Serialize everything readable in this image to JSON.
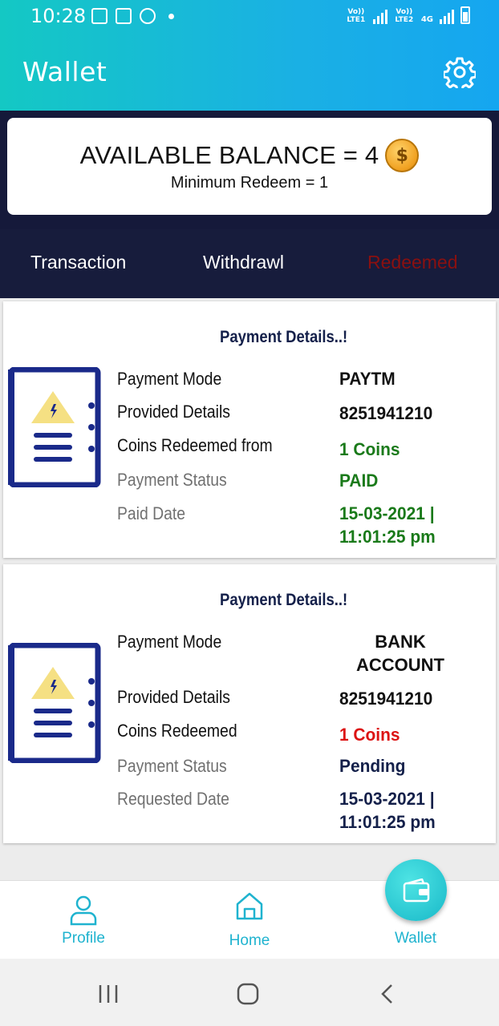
{
  "status_bar": {
    "time": "10:28",
    "sim1": "Vo)) LTE1",
    "sim2": "Vo)) LTE2",
    "network": "4G"
  },
  "header": {
    "title": "Wallet"
  },
  "balance": {
    "text": "AVAILABLE BALANCE = 4",
    "coin_symbol": "$",
    "minimum": "Minimum Redeem = 1"
  },
  "tabs": {
    "transaction": "Transaction",
    "withdrawl": "Withdrawl",
    "redeemed": "Redeemed"
  },
  "payments": [
    {
      "title": "Payment Details..!",
      "mode_label": "Payment Mode",
      "mode_value": "PAYTM",
      "details_label": "Provided Details",
      "details_value": "8251941210",
      "coins_label": "Coins Redeemed from",
      "coins_value": "1 Coins",
      "status_label": "Payment Status",
      "status_value": "PAID",
      "date_label": "Paid Date",
      "date_value_line1": "15-03-2021 |",
      "date_value_line2": "11:01:25 pm"
    },
    {
      "title": "Payment Details..!",
      "mode_label": "Payment Mode",
      "mode_value_line1": "BANK",
      "mode_value_line2": "ACCOUNT",
      "details_label": "Provided Details",
      "details_value": "8251941210",
      "coins_label": "Coins Redeemed",
      "coins_value": "1 Coins",
      "status_label": "Payment Status",
      "status_value": "Pending",
      "date_label": "Requested Date",
      "date_value_line1": "15-03-2021 |",
      "date_value_line2": "11:01:25 pm"
    }
  ],
  "bottom_nav": {
    "profile": "Profile",
    "home": "Home",
    "wallet": "Wallet"
  },
  "colors": {
    "header_gradient_start": "#14c8c4",
    "header_gradient_end": "#15a6f0",
    "dark_band": "#15193a",
    "redeemed_tab": "#8a1010",
    "green": "#1a7a1a",
    "red": "#dc1414",
    "nav_accent": "#1fb3cf"
  }
}
